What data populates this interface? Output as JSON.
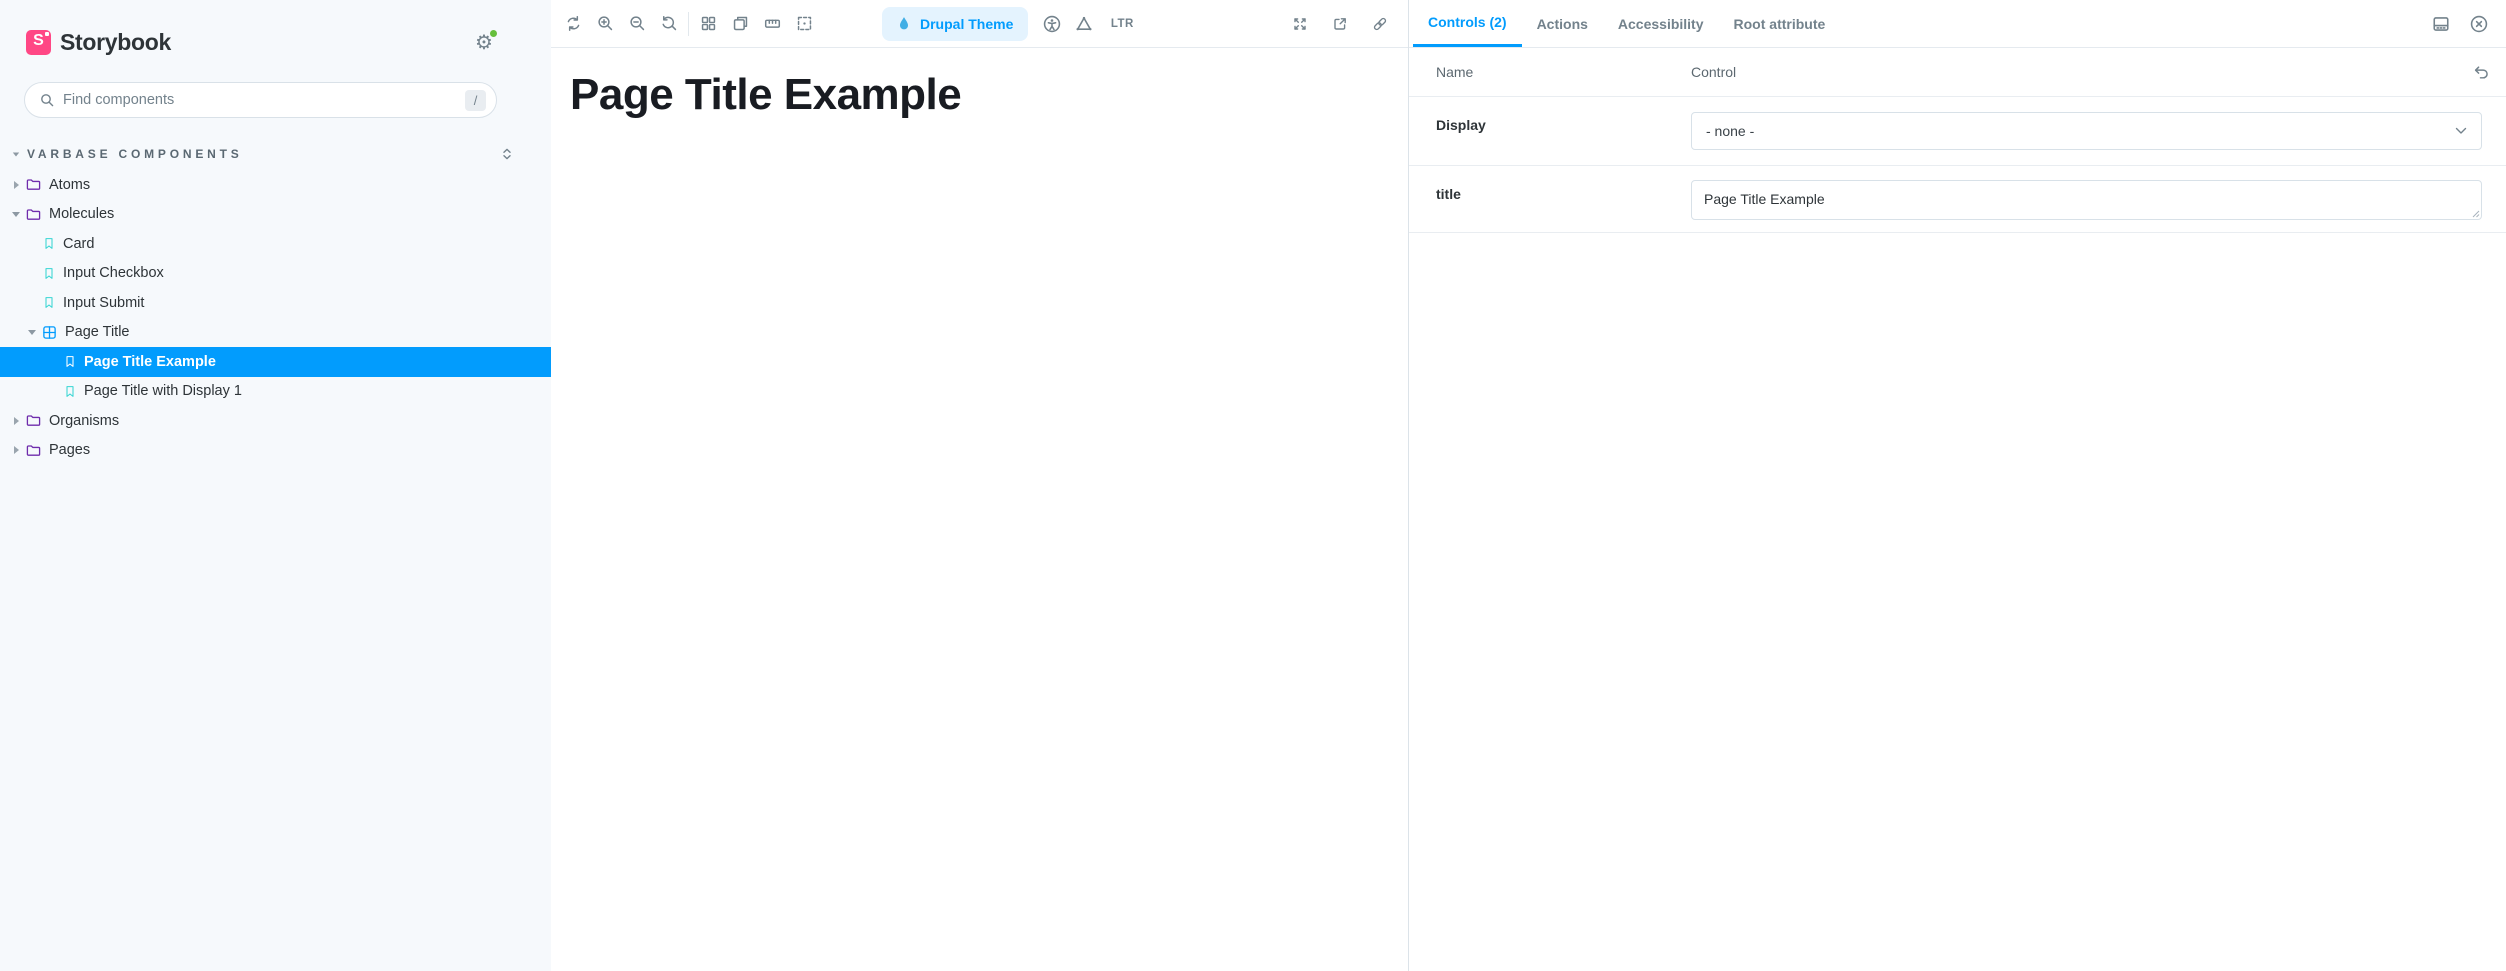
{
  "app": {
    "brand": "Storybook"
  },
  "colors": {
    "accent": "#029CFD",
    "brand_pink": "#FF4785",
    "folder_icon": "#6F2CAC",
    "story_icon": "#37D5D3",
    "selected_row_bg": "#029CFD",
    "sidebar_bg": "#F6F9FC",
    "notification_dot": "#66BF3C",
    "drupal_droplet": "#41AEE5"
  },
  "icons": {
    "gear_glyph": "⚙"
  },
  "sidebar": {
    "search": {
      "placeholder": "Find components",
      "shortcut_badge": "/"
    },
    "section_label": "VARBASE COMPONENTS",
    "tree": [
      {
        "label": "Atoms",
        "type": "folder",
        "depth": 0,
        "state": "collapsed"
      },
      {
        "label": "Molecules",
        "type": "folder",
        "depth": 0,
        "state": "expanded"
      },
      {
        "label": "Card",
        "type": "story",
        "depth": 1
      },
      {
        "label": "Input Checkbox",
        "type": "story",
        "depth": 1
      },
      {
        "label": "Input Submit",
        "type": "story",
        "depth": 1
      },
      {
        "label": "Page Title",
        "type": "component",
        "depth": 1,
        "state": "expanded"
      },
      {
        "label": "Page Title Example",
        "type": "story",
        "depth": 2,
        "selected": true
      },
      {
        "label": "Page Title with Display 1",
        "type": "story",
        "depth": 2
      },
      {
        "label": "Organisms",
        "type": "folder",
        "depth": 0,
        "state": "collapsed"
      },
      {
        "label": "Pages",
        "type": "folder",
        "depth": 0,
        "state": "collapsed"
      }
    ]
  },
  "toolbar": {
    "icons_left": [
      "remount",
      "zoom-in",
      "zoom-out",
      "zoom-reset",
      "grid",
      "backgrounds",
      "measure",
      "outline"
    ],
    "theme_button_label": "Drupal Theme",
    "icons_mid": [
      "accessibility",
      "vision-simulator"
    ],
    "direction_label": "LTR",
    "icons_right": [
      "go-fullscreen",
      "open-canvas-new-tab",
      "copy-canvas-link"
    ]
  },
  "canvas": {
    "story_title": "Page Title Example"
  },
  "panel": {
    "tabs": [
      {
        "label": "Controls (2)",
        "active": true
      },
      {
        "label": "Actions",
        "active": false
      },
      {
        "label": "Accessibility",
        "active": false
      },
      {
        "label": "Root attribute",
        "active": false
      }
    ],
    "icons_top_right": [
      "change-addons-orientation",
      "hide-addons"
    ],
    "controls": {
      "columns": [
        "Name",
        "Control"
      ],
      "rows": [
        {
          "name": "Display",
          "control": "select",
          "value": "- none -"
        },
        {
          "name": "title",
          "control": "textarea",
          "value": "Page Title Example"
        }
      ]
    }
  }
}
